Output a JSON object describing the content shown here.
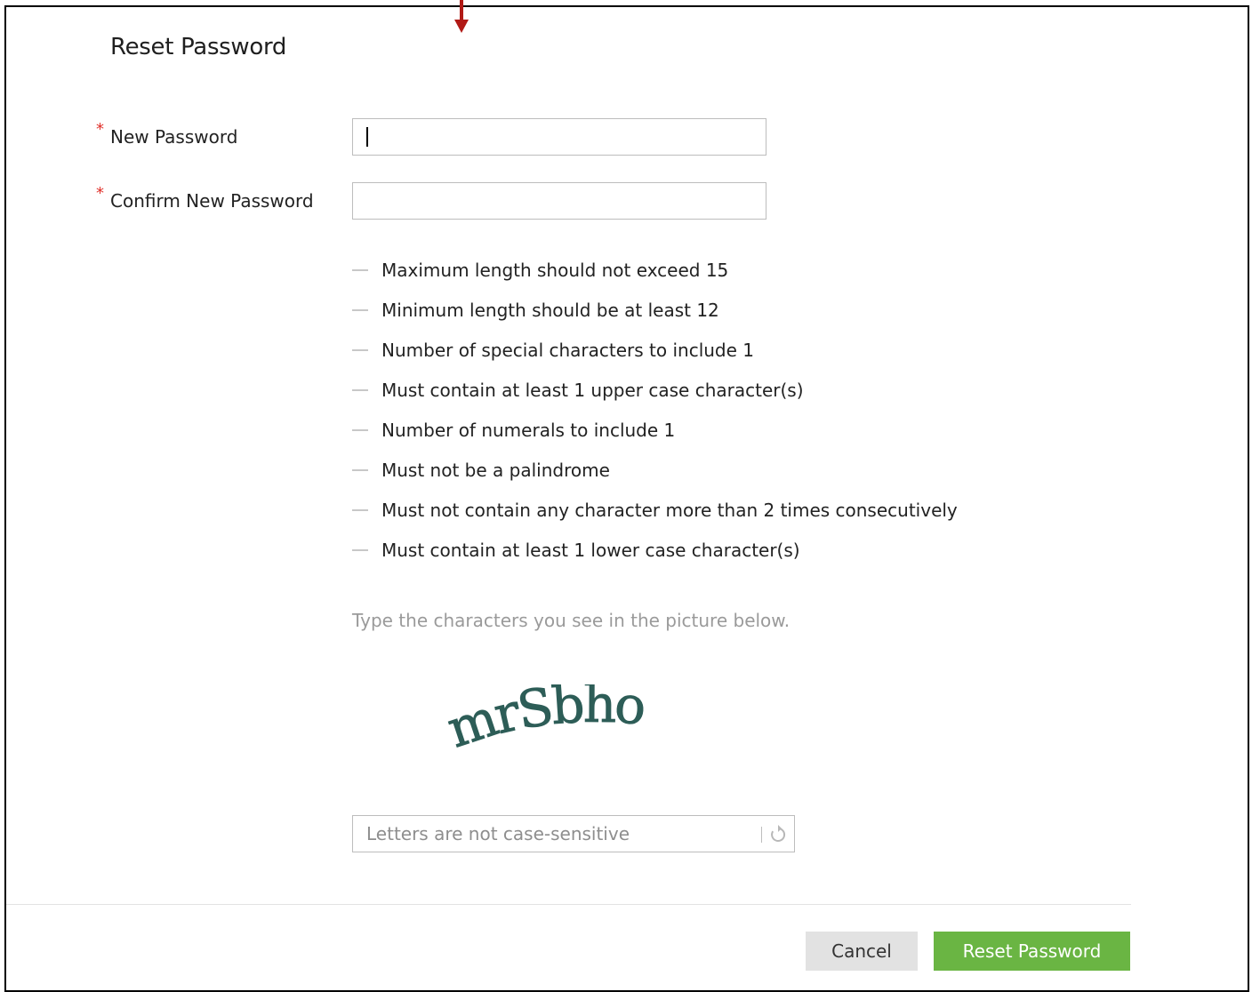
{
  "dialog": {
    "title": "Reset Password"
  },
  "form": {
    "new_password": {
      "label": "New Password",
      "required_mark": "*",
      "value": ""
    },
    "confirm_password": {
      "label": "Confirm New Password",
      "required_mark": "*",
      "value": ""
    }
  },
  "rules": [
    "Maximum length should not exceed 15",
    "Minimum length should be at least 12",
    "Number of special characters to include 1",
    "Must contain at least 1 upper case character(s)",
    "Number of numerals to include 1",
    "Must not be a palindrome",
    "Must not contain any character more than 2 times consecutively",
    "Must contain at least 1 lower case character(s)"
  ],
  "captcha": {
    "hint": "Type the characters you see in the picture below.",
    "image_text": "mrSbho",
    "input_placeholder": "Letters are not case-sensitive",
    "input_value": "",
    "refresh_icon": "refresh-icon"
  },
  "footer": {
    "cancel_label": "Cancel",
    "submit_label": "Reset Password"
  },
  "colors": {
    "required_star": "#e0302a",
    "primary_button": "#6ab543",
    "secondary_button": "#e2e2e2",
    "captcha_ink": "#2d5d57",
    "annotation_arrow": "#b11a16"
  }
}
